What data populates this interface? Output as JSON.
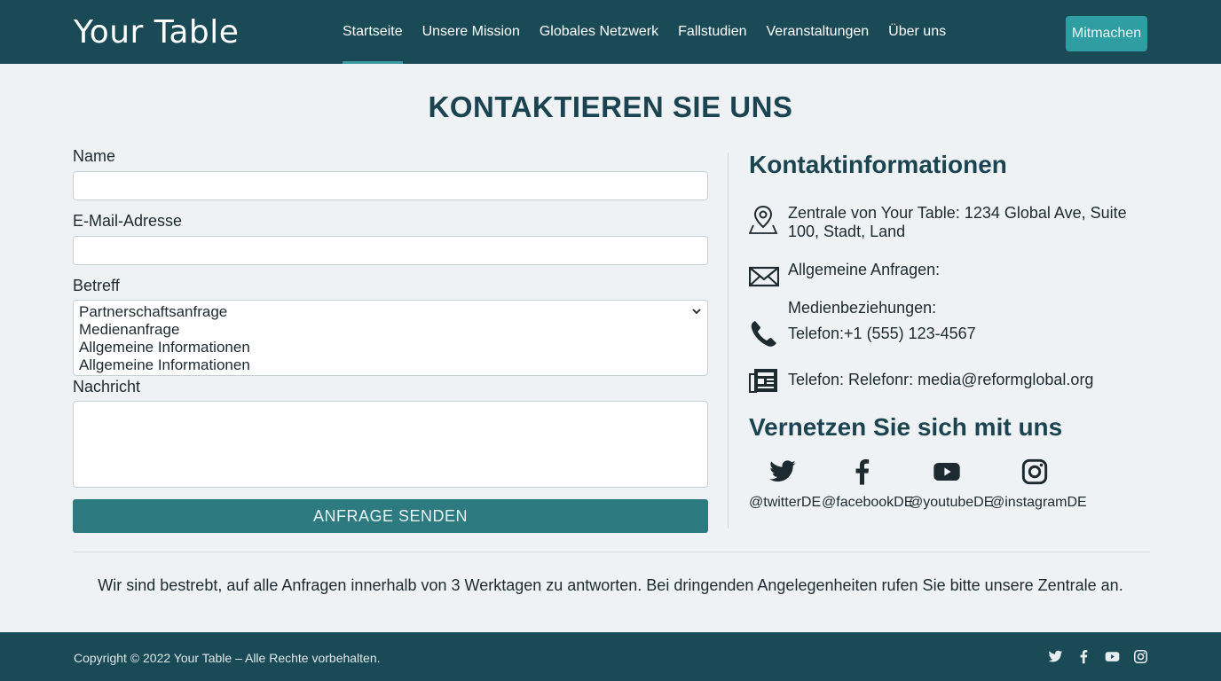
{
  "header": {
    "logo": "Your Table",
    "nav": [
      "Startseite",
      "Unsere Mission",
      "Globales Netzwerk",
      "Fallstudien",
      "Veranstaltungen",
      "Über uns"
    ],
    "active_nav": "Startseite",
    "join_button": "Mitmachen"
  },
  "page_title": "KONTAKTIEREN SIE UNS",
  "form": {
    "name_label": "Name",
    "email_label": "E-Mail-Adresse",
    "subject_label": "Betreff",
    "subject_options": [
      "Partnerschaftsanfrage",
      "Medienanfrage",
      "Allgemeine Informationen",
      "Allgemeine Informationen"
    ],
    "message_label": "Nachricht",
    "submit_label": "ANFRAGE SENDEN"
  },
  "contact": {
    "title": "Kontaktinformationen",
    "address": "Zentrale von Your Table: 1234 Global Ave, Suite 100, Stadt, Land",
    "general": "Allgemeine Anfragen:",
    "media_heading": "Medienbeziehungen:",
    "phone": "Telefon:+1 (555) 123-4567",
    "media_contact": "Telefon: Relefonr: media@reformglobal.org"
  },
  "social": {
    "title": "Vernetzen Sie sich mit uns",
    "twitter": "@twitterDE",
    "facebook": "@facebookDE",
    "youtube": "@youtubeDE",
    "instagram": "@instagramDE"
  },
  "response_note": "Wir sind bestrebt, auf alle Anfragen innerhalb von 3 Werktagen zu antworten. Bei dringenden Angelegenheiten rufen Sie bitte unsere Zentrale an.",
  "footer": {
    "copyright": "Copyright © 2022 Your Table – Alle Rechte vorbehalten."
  },
  "colors": {
    "header_bg": "#1b4a57",
    "accent": "#2f9ea3",
    "submit_bg": "#2d7b80"
  },
  "icons": [
    "map-pin-icon",
    "envelope-icon",
    "phone-icon",
    "newspaper-icon",
    "twitter-icon",
    "facebook-icon",
    "youtube-icon",
    "instagram-icon"
  ]
}
